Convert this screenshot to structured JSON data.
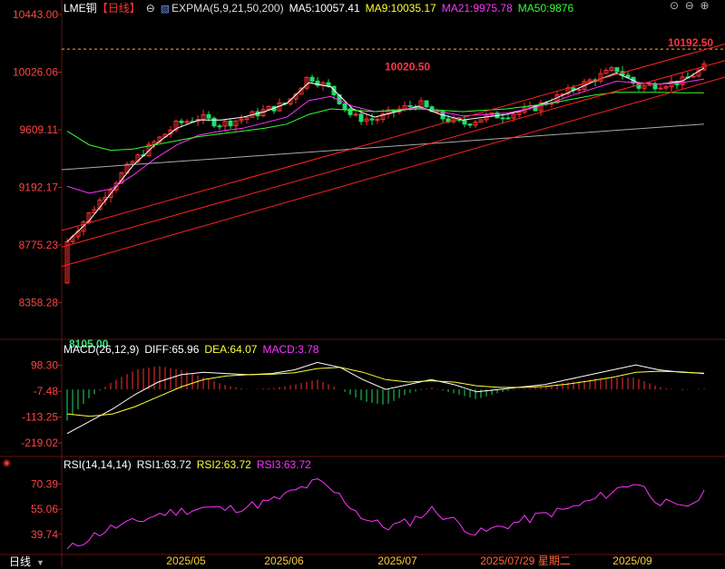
{
  "header": {
    "symbol": "LME铜",
    "period_badge": "【日线】",
    "indicator_main": "EXPMA(5,9,21,50,200)",
    "ma5": "MA5:10057.41",
    "ma9": "MA9:10035.17",
    "ma21": "MA21:9975.78",
    "ma50": "MA50:9876"
  },
  "macd_header": {
    "name": "MACD(26,12,9)",
    "diff": "DIFF:65.96",
    "dea": "DEA:64.07",
    "macd": "MACD:3.78"
  },
  "rsi_header": {
    "name": "RSI(14,14,14)",
    "rsi1": "RSI1:63.72",
    "rsi2": "RSI2:63.72",
    "rsi3": "RSI3:63.72"
  },
  "footer": {
    "period_label": "日线"
  },
  "colors": {
    "up": "#ff3030",
    "down": "#22dd66",
    "ma5": "#ffffff",
    "ma9": "#ffff33",
    "ma21": "#ff33ff",
    "ma50": "#33ff33",
    "ma200": "#aaaaaa",
    "axis_text": "#ff4444",
    "dea": "#ffff33",
    "macd_text": "#ff33ff",
    "dates": "#ffcc33",
    "date_highlight": "#ff6633"
  },
  "chart_data": [
    {
      "type": "candlestick",
      "title": "LME铜 日线",
      "y_ticks": [
        10443.0,
        10026.06,
        9609.11,
        9192.17,
        8775.23,
        8358.28
      ],
      "ylim": [
        8105,
        10443
      ],
      "x_ticks": [
        "2025/05",
        "2025/06",
        "2025/07",
        "2025/07/29 星期二",
        "2025/09"
      ],
      "annotations": [
        {
          "label": "10192.50",
          "kind": "high"
        },
        {
          "label": "10020.50",
          "kind": "local-high"
        },
        {
          "label": "8105.00",
          "kind": "low"
        }
      ],
      "approx_close_path": [
        8800,
        9000,
        9200,
        9380,
        9520,
        9650,
        9700,
        9650,
        9690,
        9750,
        9800,
        10000,
        9900,
        9700,
        9680,
        9750,
        9800,
        9700,
        9650,
        9700,
        9720,
        9750,
        9820,
        9900,
        9980,
        10050,
        9920,
        9940,
        9960,
        10058
      ],
      "series": [
        {
          "name": "MA5",
          "approx_values": [
            8800,
            8950,
            9150,
            9350,
            9500,
            9620,
            9680,
            9680,
            9700,
            9740,
            9800,
            9950,
            9920,
            9760,
            9700,
            9740,
            9780,
            9720,
            9680,
            9700,
            9720,
            9760,
            9820,
            9890,
            9960,
            10020,
            9950,
            9940,
            9960,
            10057
          ]
        },
        {
          "name": "MA21",
          "approx_values": [
            9200,
            9150,
            9180,
            9280,
            9400,
            9500,
            9570,
            9600,
            9620,
            9660,
            9700,
            9820,
            9850,
            9780,
            9740,
            9750,
            9770,
            9740,
            9710,
            9720,
            9730,
            9760,
            9800,
            9860,
            9910,
            9960,
            9950,
            9940,
            9950,
            9976
          ]
        },
        {
          "name": "MA50",
          "approx_values": [
            9600,
            9500,
            9460,
            9470,
            9500,
            9530,
            9560,
            9580,
            9600,
            9620,
            9650,
            9720,
            9760,
            9750,
            9740,
            9750,
            9760,
            9750,
            9740,
            9750,
            9760,
            9780,
            9800,
            9830,
            9860,
            9880,
            9880,
            9880,
            9876,
            9876
          ]
        }
      ]
    },
    {
      "type": "bar",
      "title": "MACD(26,12,9)",
      "y_ticks": [
        98.3,
        -7.48,
        -113.25,
        -219.02
      ],
      "ylim": [
        -270,
        130
      ],
      "series": [
        {
          "name": "DIFF",
          "approx_values": [
            -180,
            -130,
            -80,
            -20,
            30,
            60,
            70,
            65,
            60,
            65,
            80,
            110,
            90,
            40,
            0,
            20,
            40,
            20,
            -10,
            0,
            10,
            20,
            40,
            60,
            80,
            100,
            80,
            70,
            66
          ]
        },
        {
          "name": "DEA",
          "approx_values": [
            -100,
            -110,
            -100,
            -70,
            -30,
            10,
            40,
            55,
            60,
            62,
            68,
            85,
            90,
            70,
            40,
            30,
            35,
            30,
            15,
            8,
            8,
            12,
            22,
            35,
            50,
            70,
            74,
            72,
            64
          ]
        }
      ]
    },
    {
      "type": "line",
      "title": "RSI(14,14,14)",
      "y_ticks": [
        70.39,
        55.06,
        39.74
      ],
      "ylim": [
        28,
        80
      ],
      "series": [
        {
          "name": "RSI1",
          "approx_values": [
            30,
            38,
            44,
            47,
            52,
            54,
            56,
            55,
            57,
            60,
            66,
            72,
            63,
            50,
            44,
            47,
            55,
            48,
            40,
            44,
            48,
            52,
            55,
            60,
            66,
            72,
            60,
            55,
            63.72
          ]
        }
      ]
    }
  ]
}
